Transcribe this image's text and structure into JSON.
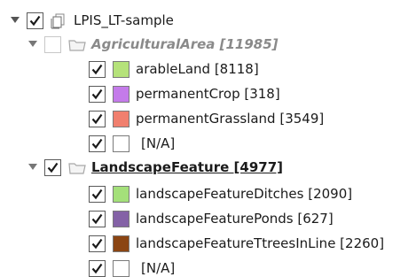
{
  "tree": {
    "root": {
      "label": "LPIS_LT-sample",
      "checked": true,
      "expanded": true,
      "icon": "layer-stack-icon"
    },
    "groups": [
      {
        "label": "AgriculturalArea [11985]",
        "checked": false,
        "expanded": true,
        "style": "italic-bold-grey",
        "icon": "folder-group-icon",
        "items": [
          {
            "label": "arableLand [8118]",
            "checked": true,
            "color": "#b5e27a"
          },
          {
            "label": "permanentCrop [318]",
            "checked": true,
            "color": "#c47bea"
          },
          {
            "label": "permanentGrassland [3549]",
            "checked": true,
            "color": "#f07f6e"
          },
          {
            "label": "[N/A]",
            "checked": true,
            "color": "#ffffff"
          }
        ]
      },
      {
        "label": "LandscapeFeature [4977]",
        "checked": true,
        "expanded": true,
        "style": "bold-underline",
        "icon": "folder-group-icon",
        "items": [
          {
            "label": "landscapeFeatureDitches [2090]",
            "checked": true,
            "color": "#a4e07a"
          },
          {
            "label": "landscapeFeaturePonds [627]",
            "checked": true,
            "color": "#8462a6"
          },
          {
            "label": "landscapeFeatureTtreesInLine [2260]",
            "checked": true,
            "color": "#8b4513"
          },
          {
            "label": "[N/A]",
            "checked": true,
            "color": "#ffffff"
          }
        ]
      }
    ]
  }
}
